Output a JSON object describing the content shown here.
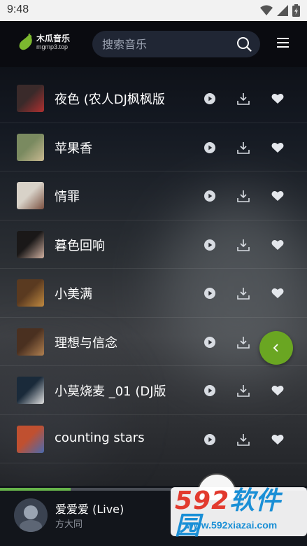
{
  "status_bar": {
    "time": "9:48"
  },
  "header": {
    "logo_cn": "木瓜音乐",
    "logo_en": "mgmp3.top",
    "search_placeholder": "搜索音乐"
  },
  "songs": [
    {
      "title": "夜色 (农人DJ枫枫版",
      "cover_colors": [
        "#3a2a2a",
        "#b03030"
      ]
    },
    {
      "title": "苹果香",
      "cover_colors": [
        "#7a8a60",
        "#c8b890"
      ]
    },
    {
      "title": "情罪",
      "cover_colors": [
        "#d8d2c8",
        "#7a5040"
      ]
    },
    {
      "title": "暮色回响",
      "cover_colors": [
        "#1a1818",
        "#d0b0a0"
      ]
    },
    {
      "title": "小美满",
      "cover_colors": [
        "#5a3a20",
        "#c08a40"
      ]
    },
    {
      "title": "理想与信念",
      "cover_colors": [
        "#4a3020",
        "#b08050"
      ]
    },
    {
      "title": "小莫烧麦 _01 (DJ版",
      "cover_colors": [
        "#1a2a3a",
        "#e0e0e0"
      ]
    },
    {
      "title": "counting stars",
      "cover_colors": [
        "#c05030",
        "#4a6ab0"
      ]
    }
  ],
  "player": {
    "title": "爱爱爱 (Live)",
    "artist": "方大同",
    "progress": 0.23
  },
  "watermark": {
    "main_prefix": "592",
    "main_suffix": "软件园",
    "url": "www.592xiazai.com"
  },
  "colors": {
    "accent_green": "#6aa622",
    "progress_green": "#66b34a",
    "watermark_blue": "#1a8fd6",
    "watermark_red": "#e23a2e"
  }
}
